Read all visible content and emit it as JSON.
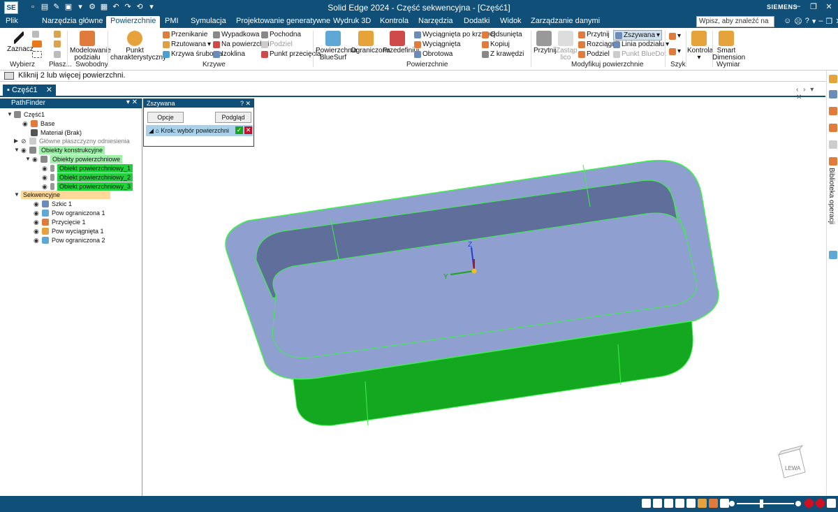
{
  "app": {
    "logo": "SE",
    "title": "Solid Edge 2024 - Część sekwencyjna - [Część1]",
    "brand": "SIEMENS"
  },
  "menu": {
    "tabs": [
      "Plik",
      "Narzędzia główne",
      "Powierzchnie",
      "PMI",
      "Symulacja",
      "Projektowanie generatywne",
      "Wydruk 3D",
      "Kontrola",
      "Narzędzia",
      "Dodatki",
      "Widok",
      "Zarządzanie danymi"
    ],
    "active": "Powierzchnie",
    "search_placeholder": "Wpisz, aby znaleźć na"
  },
  "ribbon": {
    "select": {
      "label": "Zaznacz",
      "group": "Wybierz"
    },
    "plasz_group": "Płasz...",
    "free": {
      "label1": "Modelowanie",
      "label2": "podziału",
      "group": "Swobodny"
    },
    "point": {
      "label1": "Punkt",
      "label2": "charakterystyczny"
    },
    "curves": {
      "group": "Krzywe",
      "col1": [
        "Przenikanie",
        "Rzutowana",
        "Krzywa śrubowa"
      ],
      "col2": [
        "Wypadkowa",
        "Na powierzchni",
        "Izoklina"
      ],
      "col3": [
        "Pochodna",
        "Podziel",
        "Punkt przecięcia"
      ]
    },
    "surfaces": {
      "group": "Powierzchnie",
      "bluesurf1": "Powierzchnia",
      "bluesurf2": "BlueSurf",
      "bounded": "Ograniczona",
      "redefine": "Przedefiniuj",
      "col1": [
        "Wyciągnięta po krzywej",
        "Wyciągnięta",
        "Obrotowa"
      ],
      "col2": [
        "Odsunięta",
        "Kopiuj",
        "Z krawędzi"
      ]
    },
    "modify": {
      "group": "Modyfikuj powierzchnie",
      "trim": "Przytnij",
      "replace1": "Zastąp",
      "replace2": "lico",
      "col1": [
        "Przytnij",
        "Rozciągnij",
        "Podziel"
      ],
      "col2": [
        "Zszywana",
        "Linia podziału",
        "Punkt BlueDot"
      ]
    },
    "mesh_group": "Szyk",
    "inspect": "Kontrola",
    "smartdim1": "Smart",
    "smartdim2": "Dimension",
    "dim_group": "Wymiar"
  },
  "prompt": "Kliknij 2 lub więcej powierzchni.",
  "doc_tab": "Część1",
  "pathfinder": {
    "title": "PathFinder",
    "root": "Część1",
    "items": {
      "base": "Base",
      "material": "Materiał (Brak)",
      "planes": "Główne płaszczyzny odniesienia",
      "construction": "Obiekty konstrukcyjne",
      "surface_objects": "Obiekty powierzchniowe",
      "surf1": "Obiekt powierzchniowy_1",
      "surf2": "Obiekt powierzchniowy_2",
      "surf3": "Obiekt powierzchniowy_3",
      "sequential": "Sekwencyjne",
      "sketch": "Szkic 1",
      "bounded1": "Pow ograniczona 1",
      "trim1": "Przycięcie 1",
      "extruded1": "Pow wyciągnięta 1",
      "bounded2": "Pow ograniczona 2"
    }
  },
  "command": {
    "title": "Zszywana",
    "options": "Opcje",
    "preview": "Podgląd",
    "step": "Krok: wybór powierzchni"
  },
  "viewport": {
    "axis_z": "Z",
    "axis_y": "Y",
    "view_cube_label": "LEWA"
  },
  "right_panel": {
    "library": "Biblioteka operacji"
  },
  "colors": {
    "accent": "#0f4f78",
    "surface_fill": "#8f9fd0",
    "surface_dark": "#5f6e9a",
    "green_face": "#13a81f",
    "edge_highlight": "#3cf04a"
  }
}
